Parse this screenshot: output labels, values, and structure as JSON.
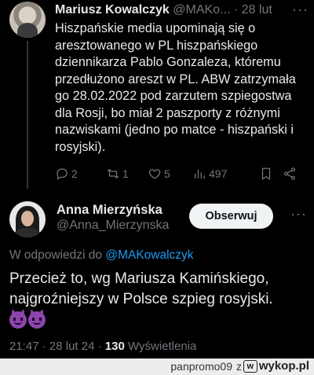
{
  "reply_tweet": {
    "author_name": "Mariusz Kowalczyk",
    "author_handle": "@MAKo...",
    "separator": "·",
    "date": "28 lut",
    "text": "Hiszpańskie media upominają się o aresztowanego w PL hiszpańskiego dziennikarza Pablo Gonzaleza, któremu przedłużono areszt w PL. ABW zatrzymała go 28.02.2022 pod zarzutem szpiegostwa dla Rosji, bo miał 2 paszporty z różnymi nazwiskami (jedno po matce - hiszpański i rosyjski).",
    "replies": "2",
    "retweets": "1",
    "likes": "5",
    "views": "497"
  },
  "main_tweet": {
    "author_name": "Anna Mierzyńska",
    "author_handle": "@Anna_Mierzynska",
    "follow_label": "Obserwuj",
    "reply_prefix": "W odpowiedzi do",
    "reply_to_handle": "@MAKowalczyk",
    "text": "Przecież to, wg Mariusza Kamińskiego, najgroźniejszy w Polsce szpieg rosyjski.",
    "time": "21:47",
    "date": "28 lut 24",
    "views_count": "130",
    "views_label": "Wyświetlenia"
  },
  "footer": {
    "user": "panpromo09",
    "separator": "z",
    "site": "wykop.pl",
    "badge": "w"
  },
  "icons": [
    "more-icon",
    "reply-icon",
    "retweet-icon",
    "like-icon",
    "views-icon",
    "bookmark-icon",
    "share-icon",
    "devil-emoji"
  ]
}
